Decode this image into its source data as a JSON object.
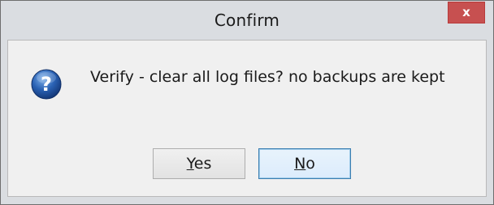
{
  "window": {
    "title": "Confirm",
    "close_label": "x"
  },
  "dialog": {
    "icon": "question-icon",
    "message": "Verify - clear all log files?  no backups are kept"
  },
  "buttons": {
    "yes": {
      "accel": "Y",
      "rest": "es"
    },
    "no": {
      "accel": "N",
      "rest": "o"
    }
  },
  "colors": {
    "titlebar": "#dadde1",
    "close_button": "#c75050",
    "client_background": "#f0f0f0",
    "default_button_border": "#3c7fb1",
    "icon_blue": "#2a62b4"
  }
}
